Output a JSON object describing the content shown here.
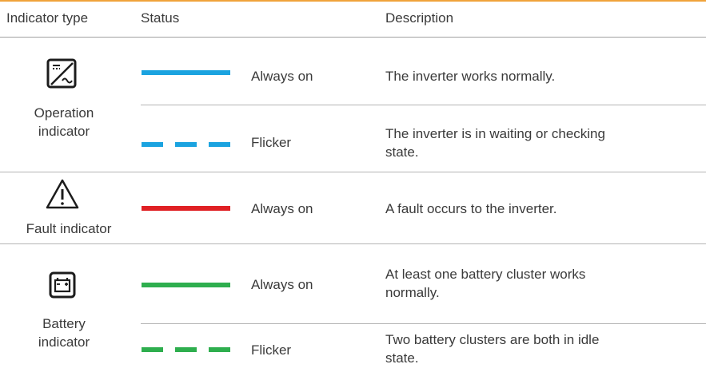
{
  "colors": {
    "blue": "#1ba3e0",
    "red": "#e02024",
    "green": "#2eae4e",
    "accent": "#f0a33a"
  },
  "header": {
    "indicator_type": "Indicator type",
    "status": "Status",
    "description": "Description"
  },
  "groups": [
    {
      "icon": "operation-icon",
      "label_line1": "Operation",
      "label_line2": "indicator",
      "rows": [
        {
          "pattern": "solid",
          "color": "blue",
          "status": "Always on",
          "description": "The inverter works normally."
        },
        {
          "pattern": "dashed",
          "color": "blue",
          "status": "Flicker",
          "description_line1": "The inverter is in waiting or checking",
          "description_line2": "state."
        }
      ]
    },
    {
      "icon": "warning-triangle-icon",
      "label_line1": "Fault indicator",
      "rows": [
        {
          "pattern": "solid",
          "color": "red",
          "status": "Always on",
          "description": "A fault occurs to the inverter."
        }
      ]
    },
    {
      "icon": "battery-icon",
      "label_line1": "Battery",
      "label_line2": "indicator",
      "rows": [
        {
          "pattern": "solid",
          "color": "green",
          "status": "Always on",
          "description_line1": "At least one battery cluster works",
          "description_line2": "normally."
        },
        {
          "pattern": "dashed",
          "color": "green",
          "status": "Flicker",
          "description_line1": "Two battery clusters are both in idle",
          "description_line2": "state."
        }
      ]
    }
  ]
}
